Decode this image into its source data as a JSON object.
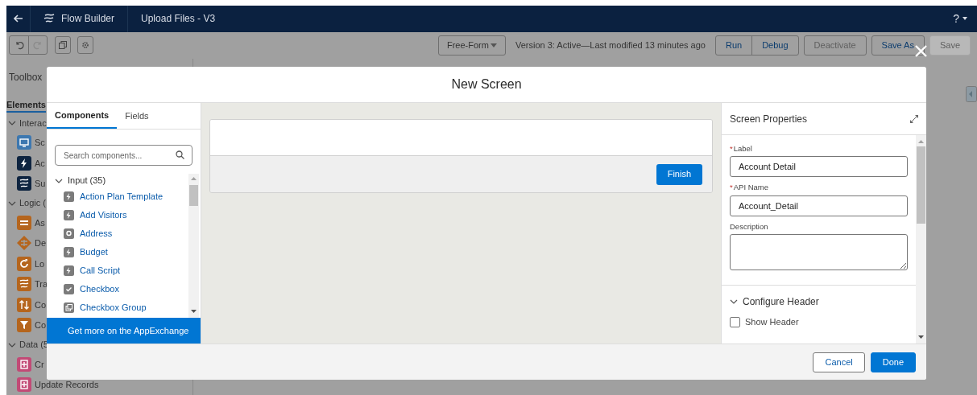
{
  "header": {
    "app_name": "Flow Builder",
    "flow_name": "Upload Files - V3",
    "help": "?"
  },
  "toolbar": {
    "layout": "Free-Form",
    "status": "Version 3: Active—Last modified 13 minutes ago",
    "history": [
      {
        "kind": "undo",
        "disabled": false
      },
      {
        "kind": "redo",
        "disabled": true
      }
    ],
    "button_groups": [
      [
        {
          "label": "Run",
          "disabled": false
        },
        {
          "label": "Debug",
          "disabled": false
        }
      ],
      [
        {
          "label": "Deactivate",
          "disabled": true
        }
      ],
      [
        {
          "label": "Save As",
          "disabled": false
        }
      ],
      [
        {
          "label": "Save",
          "disabled": true,
          "kind": "filled"
        }
      ]
    ]
  },
  "toolbox": {
    "title": "Toolbox",
    "tabs": [
      {
        "label": "Elements",
        "selected": true
      }
    ],
    "groups": [
      {
        "label": "Interac",
        "items": [
          {
            "label": "Sc",
            "color": "#3d78b0",
            "kind": "screen"
          },
          {
            "label": "Ac",
            "color": "#0e2440",
            "kind": "bolt"
          },
          {
            "label": "Su",
            "color": "#0e2440",
            "kind": "flow"
          }
        ]
      },
      {
        "label": "Logic (",
        "items": [
          {
            "label": "As",
            "color": "#b5651d",
            "kind": "equals"
          },
          {
            "label": "De",
            "color": "#b5651d",
            "kind": "diamond"
          },
          {
            "label": "Lo",
            "color": "#b5651d",
            "kind": "loop"
          },
          {
            "label": "Tra",
            "color": "#b5651d",
            "kind": "flow"
          },
          {
            "label": "Co",
            "color": "#b5651d",
            "kind": "arrows"
          },
          {
            "label": "Co",
            "color": "#b5651d",
            "kind": "filter"
          }
        ]
      },
      {
        "label": "Data (5",
        "items": [
          {
            "label": "Cr",
            "color": "#c24a76",
            "kind": "clipboard"
          },
          {
            "label": "Update Records",
            "color": "#c24a76",
            "kind": "clipboard"
          }
        ]
      }
    ]
  },
  "modal": {
    "title": "New Screen",
    "left_panel": {
      "tabs": [
        {
          "label": "Components",
          "selected": true
        },
        {
          "label": "Fields",
          "selected": false
        }
      ],
      "search": {
        "placeholder": "Search components..."
      },
      "section": {
        "label": "Input (35)",
        "expanded": true,
        "items": [
          {
            "label": "Action Plan Template",
            "kind": "bolt"
          },
          {
            "label": "Add Visitors",
            "kind": "bolt"
          },
          {
            "label": "Address",
            "kind": "pin"
          },
          {
            "label": "Budget",
            "kind": "bolt"
          },
          {
            "label": "Call Script",
            "kind": "bolt"
          },
          {
            "label": "Checkbox",
            "kind": "check"
          },
          {
            "label": "Checkbox Group",
            "kind": "group"
          }
        ]
      },
      "footer_link": "Get more on the AppExchange"
    },
    "canvas": {
      "finish_button": "Finish"
    },
    "properties": {
      "title": "Screen Properties",
      "fields": [
        {
          "label": "Label",
          "required_mark": "*",
          "value": "Account Detail",
          "kind": "input"
        },
        {
          "label": "API Name",
          "required_mark": "*",
          "value": "Account_Detail",
          "kind": "input"
        },
        {
          "label": "Description",
          "kind": "textarea"
        }
      ],
      "section": {
        "label": "Configure Header",
        "expanded": true
      },
      "show_header": {
        "label": "Show Header",
        "checked": false
      }
    },
    "buttons": [
      {
        "label": "Cancel",
        "kind": "neutral"
      },
      {
        "label": "Done",
        "kind": "brand"
      }
    ]
  }
}
